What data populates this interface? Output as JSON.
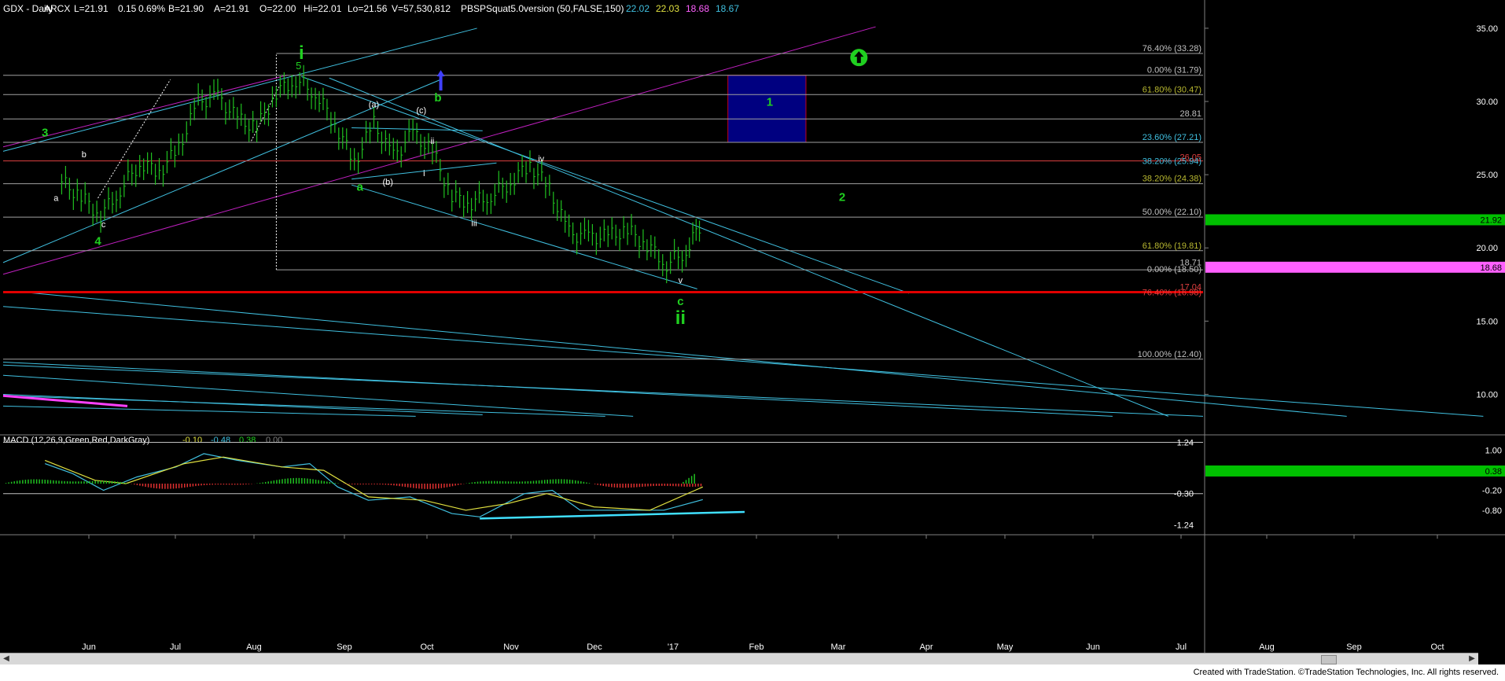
{
  "header": {
    "symbol": "GDX - Daily",
    "exchange": "ARCX",
    "last": "L=21.91",
    "chg": "0.15",
    "pct": "0.69%",
    "bid": "B=21.90",
    "ask": "A=21.91",
    "open": "O=22.00",
    "hi": "Hi=22.01",
    "lo": "Lo=21.56",
    "vol": "V=57,530,812",
    "study": "PBSPSquat5.0version (50,FALSE,150)",
    "v1": "22.02",
    "v2": "22.03",
    "v3": "18.68",
    "v4": "18.67",
    "colors": {
      "v1": "#40c0e0",
      "v2": "#e0e040",
      "v3": "#ff60ff",
      "v4": "#40c0e0"
    }
  },
  "macd_header": {
    "label": "MACD (12,26,9,Green,Red,DarkGray)",
    "v1": "-0.10",
    "v2": "-0.48",
    "v3": "0.38",
    "v4": "0.00"
  },
  "footer": {
    "credit": "Created with TradeStation. ©TradeStation Technologies, Inc. All rights reserved."
  },
  "chart_data": [
    {
      "type": "line",
      "title": "GDX - Daily",
      "x_tick_labels": [
        "Jun",
        "Jul",
        "Aug",
        "Sep",
        "Oct",
        "Nov",
        "Dec",
        "'17",
        "Feb",
        "Mar",
        "Apr",
        "May",
        "Jun",
        "Jul",
        "Aug",
        "Sep",
        "Oct"
      ],
      "y_tick_labels": [
        "35.00",
        "30.00",
        "25.00",
        "20.00",
        "15.00",
        "10.00"
      ],
      "ylim": [
        7.5,
        36.5
      ],
      "grid": false,
      "price_series_daily_close_approx": [
        {
          "x": "2016-05-18",
          "y": 24.5
        },
        {
          "x": "2016-05-25",
          "y": 23.5
        },
        {
          "x": "2016-06-01",
          "y": 22.2
        },
        {
          "x": "2016-06-08",
          "y": 24.0
        },
        {
          "x": "2016-06-15",
          "y": 25.8
        },
        {
          "x": "2016-06-22",
          "y": 25.2
        },
        {
          "x": "2016-06-29",
          "y": 26.8
        },
        {
          "x": "2016-07-06",
          "y": 30.0
        },
        {
          "x": "2016-07-13",
          "y": 30.3
        },
        {
          "x": "2016-07-20",
          "y": 28.8
        },
        {
          "x": "2016-07-27",
          "y": 28.2
        },
        {
          "x": "2016-08-03",
          "y": 30.6
        },
        {
          "x": "2016-08-10",
          "y": 31.5
        },
        {
          "x": "2016-08-17",
          "y": 30.6
        },
        {
          "x": "2016-08-24",
          "y": 28.5
        },
        {
          "x": "2016-08-31",
          "y": 25.8
        },
        {
          "x": "2016-09-07",
          "y": 28.5
        },
        {
          "x": "2016-09-14",
          "y": 26.2
        },
        {
          "x": "2016-09-21",
          "y": 27.8
        },
        {
          "x": "2016-09-28",
          "y": 26.6
        },
        {
          "x": "2016-10-05",
          "y": 23.5
        },
        {
          "x": "2016-10-12",
          "y": 23.1
        },
        {
          "x": "2016-10-19",
          "y": 23.6
        },
        {
          "x": "2016-10-26",
          "y": 24.5
        },
        {
          "x": "2016-11-02",
          "y": 25.7
        },
        {
          "x": "2016-11-09",
          "y": 24.0
        },
        {
          "x": "2016-11-16",
          "y": 21.0
        },
        {
          "x": "2016-11-23",
          "y": 20.7
        },
        {
          "x": "2016-11-30",
          "y": 20.8
        },
        {
          "x": "2016-12-07",
          "y": 21.2
        },
        {
          "x": "2016-12-14",
          "y": 20.2
        },
        {
          "x": "2016-12-21",
          "y": 18.9
        },
        {
          "x": "2016-12-28",
          "y": 19.8
        },
        {
          "x": "2017-01-03",
          "y": 21.9
        }
      ],
      "levels": [
        {
          "label": "76.40% (33.28)",
          "y": 33.28,
          "color": "#c0c0c0"
        },
        {
          "label": "0.00% (31.79)",
          "y": 31.79,
          "color": "#c0c0c0"
        },
        {
          "label": "61.80% (30.47)",
          "y": 30.47,
          "color": "#b8b830"
        },
        {
          "label": "28.81",
          "y": 28.81,
          "color": "#c0c0c0"
        },
        {
          "label": "23.60% (27.21)",
          "y": 27.21,
          "color": "#40c0e0"
        },
        {
          "label": "38.20% (25.94)",
          "y": 25.94,
          "color": "#40c0e0"
        },
        {
          "label": "26.05",
          "y": 26.05,
          "color": "#e04040"
        },
        {
          "label": "38.20% (24.38)",
          "y": 24.38,
          "color": "#b8b830"
        },
        {
          "label": "50.00% (22.10)",
          "y": 22.1,
          "color": "#c0c0c0"
        },
        {
          "label": "61.80% (19.81)",
          "y": 19.81,
          "color": "#b8b830"
        },
        {
          "label": "18.71",
          "y": 18.71,
          "color": "#c0c0c0"
        },
        {
          "label": "0.00% (18.50)",
          "y": 18.5,
          "color": "#c0c0c0"
        },
        {
          "label": "17.04",
          "y": 17.04,
          "color": "#e04040"
        },
        {
          "label": "76.40% (16.98)",
          "y": 16.98,
          "color": "#e04040"
        },
        {
          "label": "100.00% (12.40)",
          "y": 12.4,
          "color": "#c0c0c0"
        }
      ],
      "price_tags": [
        {
          "label": "21.92",
          "y": 21.92,
          "color": "#00c000"
        },
        {
          "label": "18.68",
          "y": 18.68,
          "color": "#ff60ff"
        }
      ],
      "wave_labels": [
        {
          "text": "3",
          "x": "2016-05-12",
          "y": 27.6,
          "color": "#20d020",
          "size": 15
        },
        {
          "text": "a",
          "x": "2016-05-16",
          "y": 23.2,
          "color": "#ffffff",
          "size": 11
        },
        {
          "text": "b",
          "x": "2016-05-26",
          "y": 26.2,
          "color": "#ffffff",
          "size": 11
        },
        {
          "text": "c",
          "x": "2016-06-02",
          "y": 21.4,
          "color": "#ffffff",
          "size": 11
        },
        {
          "text": "4",
          "x": "2016-05-31",
          "y": 20.2,
          "color": "#20d020",
          "size": 15
        },
        {
          "text": "i",
          "x": "2016-08-12",
          "y": 32.9,
          "color": "#20d020",
          "size": 24
        },
        {
          "text": "5",
          "x": "2016-08-11",
          "y": 32.2,
          "color": "#20d020",
          "size": 13
        },
        {
          "text": "(a)",
          "x": "2016-09-07",
          "y": 29.6,
          "color": "#ffffff",
          "size": 11
        },
        {
          "text": "b",
          "x": "2016-09-30",
          "y": 30.0,
          "color": "#20d020",
          "size": 15
        },
        {
          "text": "(c)",
          "x": "2016-09-24",
          "y": 29.2,
          "color": "#ffffff",
          "size": 11
        },
        {
          "text": "ii",
          "x": "2016-09-28",
          "y": 27.1,
          "color": "#ffffff",
          "size": 11
        },
        {
          "text": "i",
          "x": "2016-09-25",
          "y": 24.9,
          "color": "#ffffff",
          "size": 11
        },
        {
          "text": "(b)",
          "x": "2016-09-12",
          "y": 24.3,
          "color": "#ffffff",
          "size": 11
        },
        {
          "text": "a",
          "x": "2016-09-02",
          "y": 23.9,
          "color": "#20d020",
          "size": 15
        },
        {
          "text": "iii",
          "x": "2016-10-13",
          "y": 21.5,
          "color": "#ffffff",
          "size": 11
        },
        {
          "text": "iv",
          "x": "2016-11-06",
          "y": 25.9,
          "color": "#ffffff",
          "size": 11
        },
        {
          "text": "v",
          "x": "2016-12-26",
          "y": 17.6,
          "color": "#ffffff",
          "size": 11
        },
        {
          "text": "c",
          "x": "2016-12-26",
          "y": 16.1,
          "color": "#20d020",
          "size": 15
        },
        {
          "text": "ii",
          "x": "2016-12-26",
          "y": 14.8,
          "color": "#20d020",
          "size": 24
        },
        {
          "text": "1",
          "x": "2017-01-27",
          "y": 29.7,
          "color": "#20d020",
          "size": 15
        },
        {
          "text": "2",
          "x": "2017-02-22",
          "y": 23.2,
          "color": "#20d020",
          "size": 15
        }
      ],
      "target_box": {
        "x0": "2017-01-12",
        "x1": "2017-02-09",
        "y0": 27.21,
        "y1": 31.79,
        "fill": "#000080",
        "edge": "#c00020"
      },
      "arrow_up_marker": {
        "x": "2017-02-28",
        "y": 33.0,
        "color": "#20d020"
      },
      "blue_arrow_marker": {
        "x": "2016-10-01",
        "y": 31.5,
        "color": "#4040ff"
      }
    },
    {
      "type": "bar",
      "title": "MACD (12,26,9,Green,Red,DarkGray)",
      "y_tick_labels": [
        "1.24",
        "1.00",
        "0.38",
        "-0.20",
        "-0.30",
        "-0.80",
        "-1.24"
      ],
      "ylim": [
        -1.3,
        1.3
      ],
      "series": [
        {
          "name": "MACD",
          "color": "#40c0e0",
          "values": [
            {
              "x": "2016-05-12",
              "y": 0.6
            },
            {
              "x": "2016-05-22",
              "y": 0.3
            },
            {
              "x": "2016-06-02",
              "y": -0.2
            },
            {
              "x": "2016-06-14",
              "y": 0.2
            },
            {
              "x": "2016-06-28",
              "y": 0.5
            },
            {
              "x": "2016-07-08",
              "y": 0.9
            },
            {
              "x": "2016-07-20",
              "y": 0.7
            },
            {
              "x": "2016-08-05",
              "y": 0.5
            },
            {
              "x": "2016-08-15",
              "y": 0.6
            },
            {
              "x": "2016-08-25",
              "y": -0.1
            },
            {
              "x": "2016-09-05",
              "y": -0.5
            },
            {
              "x": "2016-09-20",
              "y": -0.4
            },
            {
              "x": "2016-10-05",
              "y": -0.9
            },
            {
              "x": "2016-10-15",
              "y": -1.0
            },
            {
              "x": "2016-10-31",
              "y": -0.3
            },
            {
              "x": "2016-11-10",
              "y": -0.2
            },
            {
              "x": "2016-11-20",
              "y": -0.8
            },
            {
              "x": "2016-12-05",
              "y": -0.8
            },
            {
              "x": "2016-12-20",
              "y": -0.8
            },
            {
              "x": "2017-01-03",
              "y": -0.48
            }
          ]
        },
        {
          "name": "Signal",
          "color": "#e0e040",
          "values": [
            {
              "x": "2016-05-12",
              "y": 0.7
            },
            {
              "x": "2016-05-30",
              "y": 0.1
            },
            {
              "x": "2016-06-10",
              "y": 0.0
            },
            {
              "x": "2016-07-01",
              "y": 0.6
            },
            {
              "x": "2016-07-15",
              "y": 0.8
            },
            {
              "x": "2016-08-05",
              "y": 0.5
            },
            {
              "x": "2016-08-20",
              "y": 0.4
            },
            {
              "x": "2016-09-05",
              "y": -0.4
            },
            {
              "x": "2016-09-25",
              "y": -0.5
            },
            {
              "x": "2016-10-10",
              "y": -0.8
            },
            {
              "x": "2016-10-25",
              "y": -0.6
            },
            {
              "x": "2016-11-08",
              "y": -0.3
            },
            {
              "x": "2016-11-25",
              "y": -0.7
            },
            {
              "x": "2016-12-15",
              "y": -0.8
            },
            {
              "x": "2017-01-03",
              "y": -0.1
            }
          ]
        }
      ],
      "histogram_note": "green/red histogram bars around zero"
    }
  ]
}
